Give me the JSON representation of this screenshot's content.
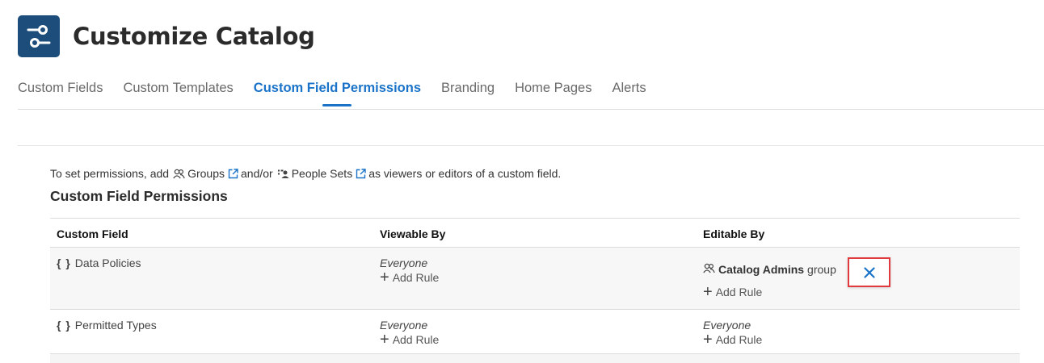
{
  "header": {
    "title": "Customize Catalog",
    "icon": "settings-sliders-icon",
    "icon_color": "#1d4e7b"
  },
  "tabs": [
    {
      "label": "Custom Fields",
      "active": false
    },
    {
      "label": "Custom Templates",
      "active": false
    },
    {
      "label": "Custom Field Permissions",
      "active": true
    },
    {
      "label": "Branding",
      "active": false
    },
    {
      "label": "Home Pages",
      "active": false
    },
    {
      "label": "Alerts",
      "active": false
    }
  ],
  "accent_color": "#1a73c8",
  "intro": {
    "prefix": "To set permissions, add",
    "groups_label": "Groups",
    "middle": "and/or",
    "people_sets_label": "People Sets",
    "suffix": "as viewers or editors of a custom field."
  },
  "section_title": "Custom Field Permissions",
  "table": {
    "headers": [
      "Custom Field",
      "Viewable By",
      "Editable By"
    ],
    "rows": [
      {
        "field": "Data Policies",
        "viewable": {
          "text": "Everyone",
          "add_rule": "Add Rule"
        },
        "editable": {
          "group_name": "Catalog Admins",
          "group_suffix": "group",
          "add_rule": "Add Rule",
          "remove_icon": "close-x-icon"
        }
      },
      {
        "field": "Permitted Types",
        "viewable": {
          "text": "Everyone",
          "add_rule": "Add Rule"
        },
        "editable": {
          "text": "Everyone",
          "add_rule": "Add Rule"
        }
      }
    ]
  },
  "field_icon_text": "{ }"
}
